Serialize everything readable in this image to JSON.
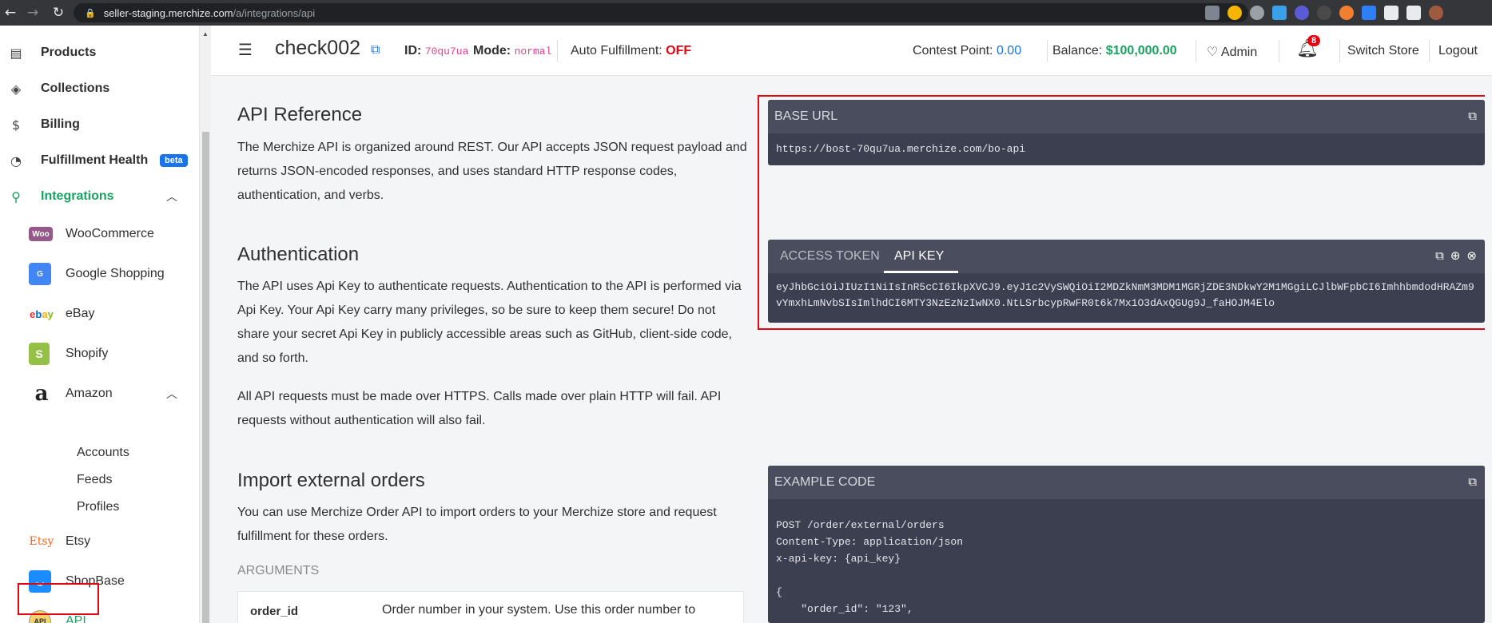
{
  "browser": {
    "url_host": "seller-staging.merchize.com",
    "url_path": "/a/integrations/api"
  },
  "sidebar": {
    "items": [
      {
        "label": "Products",
        "icon": "box-icon"
      },
      {
        "label": "Collections",
        "icon": "cube-icon"
      },
      {
        "label": "Billing",
        "icon": "dollar-icon"
      },
      {
        "label": "Fulfillment Health",
        "icon": "pie-chart-icon",
        "badge": "beta"
      },
      {
        "label": "Integrations",
        "icon": "plug-icon"
      }
    ],
    "integrations": [
      {
        "label": "WooCommerce",
        "brand": "Woo"
      },
      {
        "label": "Google Shopping",
        "brand": "G"
      },
      {
        "label": "eBay",
        "brand": "ebay"
      },
      {
        "label": "Shopify",
        "brand": "S"
      },
      {
        "label": "Amazon",
        "brand": "a"
      },
      {
        "label": "Etsy",
        "brand": "Etsy"
      },
      {
        "label": "ShopBase",
        "brand": "SB"
      },
      {
        "label": "API",
        "brand": "API"
      }
    ],
    "amazon_sub": [
      "Accounts",
      "Feeds",
      "Profiles"
    ]
  },
  "header": {
    "store_name": "check002",
    "id_label": "ID:",
    "id_value": "70qu7ua",
    "mode_label": "Mode:",
    "mode_value": "normal",
    "auto_fulfillment_label": "Auto Fulfillment:",
    "auto_fulfillment_value": "OFF",
    "contest_label": "Contest Point:",
    "contest_value": "0.00",
    "balance_label": "Balance:",
    "balance_value": "$100,000.00",
    "admin_label": "Admin",
    "notification_count": "8",
    "switch_store": "Switch Store",
    "logout": "Logout"
  },
  "content": {
    "api_reference_title": "API Reference",
    "api_reference_text": "The Merchize API is organized around REST. Our API accepts JSON request payload and returns JSON-encoded responses, and uses standard HTTP response codes, authentication, and verbs.",
    "auth_title": "Authentication",
    "auth_text1": "The API uses Api Key to authenticate requests. Authentication to the API is performed via Api Key. Your Api Key carry many privileges, so be sure to keep them secure! Do not share your secret Api Key in publicly accessible areas such as GitHub, client-side code, and so forth.",
    "auth_text2": "All API requests must be made over HTTPS. Calls made over plain HTTP will fail. API requests without authentication will also fail.",
    "import_title": "Import external orders",
    "import_text": "You can use Merchize Order API to import orders to your Merchize store and request fulfillment for these orders.",
    "arguments_label": "ARGUMENTS",
    "arg_key": "order_id",
    "arg_desc": "Order number in your system. Use this order number to"
  },
  "base_url_panel": {
    "title": "BASE URL",
    "value": "https://bost-70qu7ua.merchize.com/bo-api"
  },
  "token_panel": {
    "tab_access_token": "ACCESS TOKEN",
    "tab_api_key": "API KEY",
    "value": "eyJhbGciOiJIUzI1NiIsInR5cCI6IkpXVCJ9.eyJ1c2VySWQiOiI2MDZkNmM3MDM1MGRjZDE3NDkwY2M1MGgiLCJlbWFpbCI6ImhhbmdodHRAZm9vYmxhLmNvbSIsImlhdCI6MTY3NzEzNzIwNX0.NtLSrbcypRwFR0t6k7Mx1O3dAxQGUg9J_faHOJM4Elo"
  },
  "example_panel": {
    "title": "EXAMPLE CODE",
    "code": "POST /order/external/orders\nContent-Type: application/json\nx-api-key: {api_key}\n\n{\n    \"order_id\": \"123\","
  },
  "colors": {
    "accent_green": "#1aa260",
    "accent_blue": "#1a73e8",
    "alert_red": "#e30613",
    "panel_bg": "#3c3f4f"
  }
}
